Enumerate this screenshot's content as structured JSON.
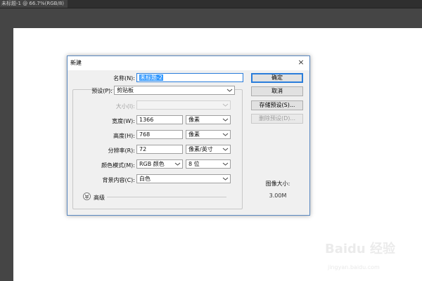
{
  "app": {
    "doc_tab_label": "未标题-1 @ 66.7%(RGB/8)",
    "doc_tab_close": "×"
  },
  "dialog": {
    "title": "新建",
    "close": "×",
    "name_label": "名称(N):",
    "name_value": "未标题-2",
    "preset_label": "预设(P):",
    "preset_value": "剪贴板",
    "size_label": "大小(I):",
    "size_value": "",
    "width_label": "宽度(W):",
    "width_value": "1366",
    "width_unit": "像素",
    "height_label": "高度(H):",
    "height_value": "768",
    "height_unit": "像素",
    "resolution_label": "分辨率(R):",
    "resolution_value": "72",
    "resolution_unit": "像素/英寸",
    "color_mode_label": "颜色模式(M):",
    "color_mode_value": "RGB 颜色",
    "bit_depth_value": "8 位",
    "background_label": "背景内容(C):",
    "background_value": "白色",
    "advanced_label": "高级",
    "buttons": {
      "ok": "确定",
      "cancel": "取消",
      "save_preset": "存储预设(S)...",
      "delete_preset": "删除预设(D)..."
    },
    "image_size_label": "图像大小:",
    "image_size_value": "3.00M"
  },
  "watermark": {
    "brand": "Baidu 经验",
    "url": "jingyan.baidu.com"
  },
  "colors": {
    "accent": "#2a7ddb",
    "selection": "#3399ff",
    "workspace": "#454545"
  }
}
